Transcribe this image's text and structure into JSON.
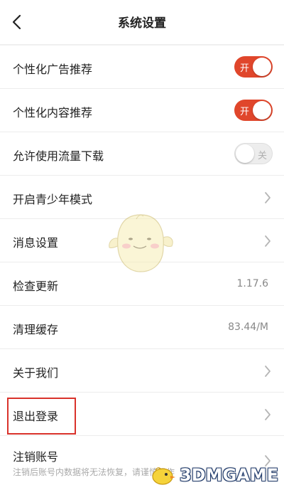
{
  "header": {
    "title": "系统设置",
    "back_icon": "chevron-left-icon"
  },
  "settings": [
    {
      "label": "个性化广告推荐",
      "type": "toggle",
      "on": true,
      "toggle_text": "开"
    },
    {
      "label": "个性化内容推荐",
      "type": "toggle",
      "on": true,
      "toggle_text": "开"
    },
    {
      "label": "允许使用流量下载",
      "type": "toggle",
      "on": false,
      "toggle_text": "关"
    },
    {
      "label": "开启青少年模式",
      "type": "link"
    },
    {
      "label": "消息设置",
      "type": "link"
    },
    {
      "label": "检查更新",
      "type": "value",
      "value": "1.17.6"
    },
    {
      "label": "清理缓存",
      "type": "value",
      "value": "83.44/M"
    },
    {
      "label": "关于我们",
      "type": "link"
    },
    {
      "label": "退出登录",
      "type": "link",
      "highlighted": true
    },
    {
      "label": "注销账号",
      "type": "link",
      "sub": "注销后账号内数据将无法恢复，请谨慎操作"
    }
  ],
  "colors": {
    "accent": "#e0462b",
    "highlight_box": "#d9322b"
  },
  "watermark": {
    "text": "3DMGAME"
  }
}
